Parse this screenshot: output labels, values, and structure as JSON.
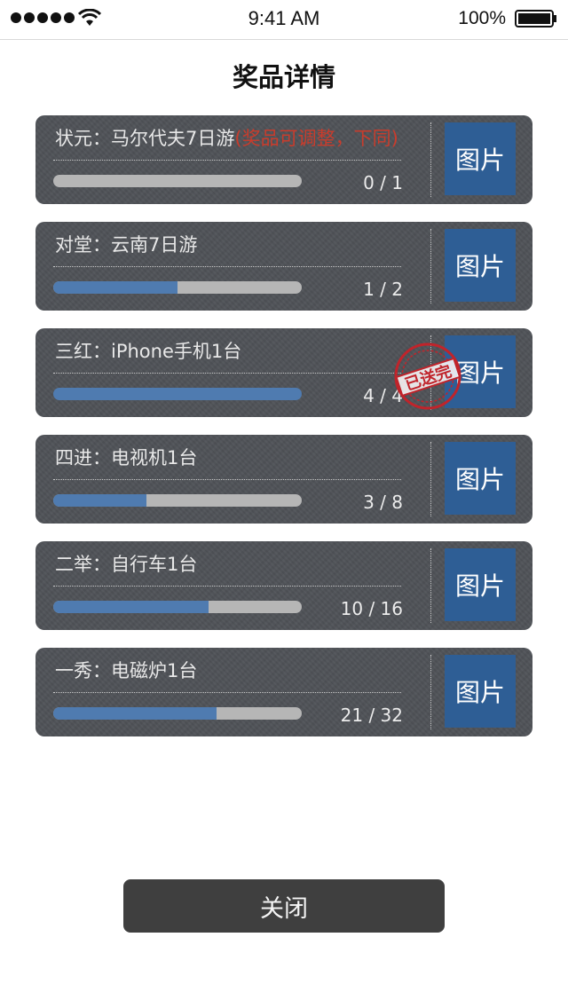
{
  "status_bar": {
    "time": "9:41 AM",
    "battery": "100%"
  },
  "page": {
    "title": "奖品详情",
    "close_label": "关闭"
  },
  "prizes": [
    {
      "title": "状元：马尔代夫7日游",
      "note": "(奖品可调整，下同)",
      "count": "0 / 1",
      "progress": 0,
      "image_label": "图片"
    },
    {
      "title": "对堂：云南7日游",
      "note": "",
      "count": "1 / 2",
      "progress": 0.5,
      "image_label": "图片"
    },
    {
      "title": "三红：iPhone手机1台",
      "note": "",
      "count": "4 / 4",
      "progress": 1,
      "image_label": "图片",
      "stamp": "已送完"
    },
    {
      "title": "四进：电视机1台",
      "note": "",
      "count": "3 / 8",
      "progress": 0.375,
      "image_label": "图片"
    },
    {
      "title": "二举：自行车1台",
      "note": "",
      "count": "10 / 16",
      "progress": 0.625,
      "image_label": "图片"
    },
    {
      "title": "一秀：电磁炉1台",
      "note": "",
      "count": "21 / 32",
      "progress": 0.65625,
      "image_label": "图片"
    }
  ],
  "colors": {
    "card": "#4f5257",
    "progress_fill": "#4f7bb0",
    "progress_track": "#b6b6b6",
    "image_button": "#2e5e95",
    "note": "#c93c2c",
    "stamp": "#c0242b",
    "close_button": "#3f3f3f"
  },
  "icons": {
    "signal": "signal-dots-icon",
    "wifi": "wifi-icon",
    "battery": "battery-icon",
    "stamp": "sold-out-stamp-icon"
  }
}
